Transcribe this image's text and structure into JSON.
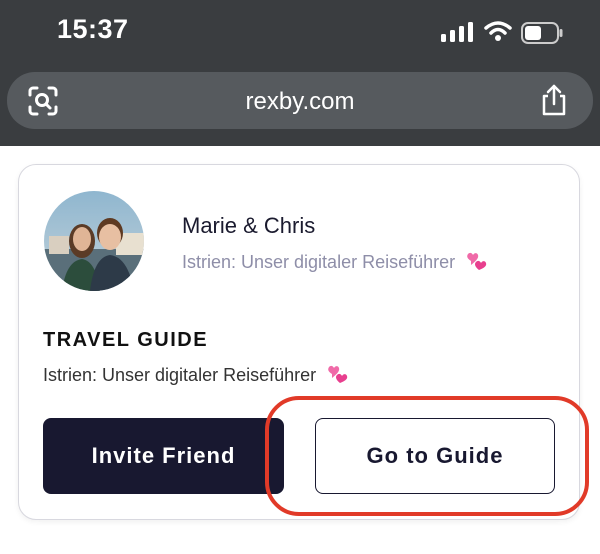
{
  "status_bar": {
    "time": "15:37"
  },
  "browser": {
    "url": "rexby.com"
  },
  "author": {
    "name": "Marie & Chris",
    "subtitle": "Istrien: Unser digitaler Reiseführer"
  },
  "guide": {
    "section_title": "TRAVEL GUIDE",
    "description": "Istrien: Unser digitaler Reiseführer"
  },
  "buttons": {
    "invite_label": "Invite Friend",
    "guide_label": "Go to Guide"
  },
  "icons": {
    "emoji": "two-hearts-icon"
  },
  "colors": {
    "highlight": "#e13a28",
    "primary_button": "#181830",
    "chrome": "#3a3d40"
  }
}
